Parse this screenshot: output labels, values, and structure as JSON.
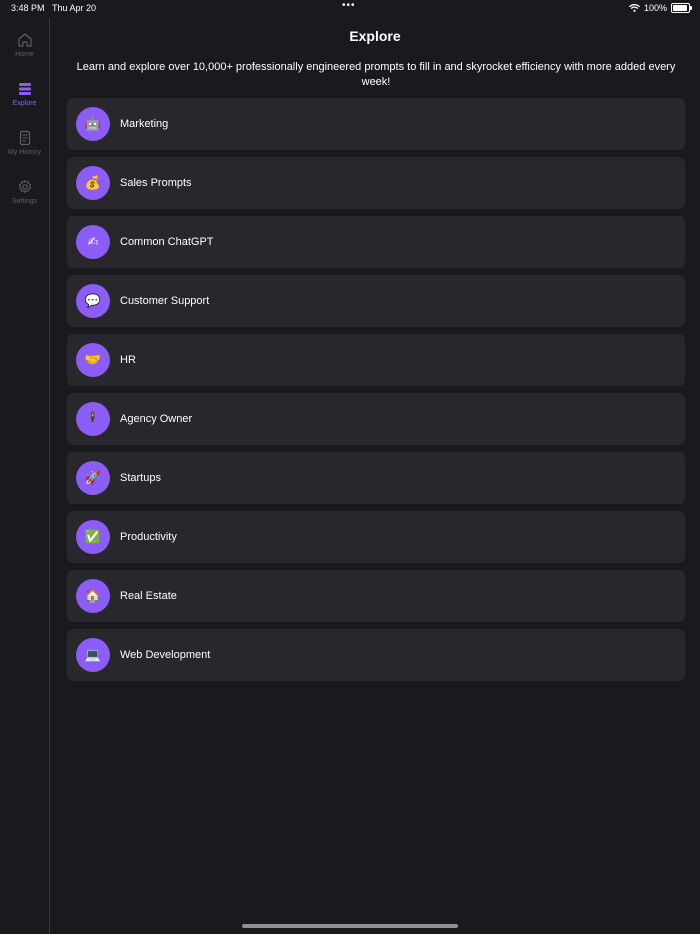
{
  "status": {
    "time": "3:48 PM",
    "date": "Thu Apr 20",
    "battery": "100%"
  },
  "sidebar": {
    "items": [
      {
        "label": "Home",
        "icon": "home-icon",
        "active": false
      },
      {
        "label": "Explore",
        "icon": "explore-icon",
        "active": true
      },
      {
        "label": "My History",
        "icon": "history-icon",
        "active": false
      },
      {
        "label": "Settings",
        "icon": "gear-icon",
        "active": false
      }
    ]
  },
  "page": {
    "title": "Explore",
    "subtitle": "Learn and explore over 10,000+ professionally engineered prompts to fill in and skyrocket efficiency with more added every week!"
  },
  "categories": [
    {
      "label": "Marketing",
      "emoji": "🤖"
    },
    {
      "label": "Sales Prompts",
      "emoji": "💰"
    },
    {
      "label": "Common ChatGPT",
      "emoji": "✍"
    },
    {
      "label": "Customer Support",
      "emoji": "💬"
    },
    {
      "label": "HR",
      "emoji": "🤝"
    },
    {
      "label": "Agency Owner",
      "emoji": "🕴"
    },
    {
      "label": "Startups",
      "emoji": "🚀"
    },
    {
      "label": "Productivity",
      "emoji": "✅"
    },
    {
      "label": "Real Estate",
      "emoji": "🏠"
    },
    {
      "label": "Web Development",
      "emoji": "💻"
    }
  ],
  "colors": {
    "accent": "#8b5cf6",
    "background": "#1a1a1e",
    "card": "#27272c",
    "inactive": "#5e5e66"
  }
}
